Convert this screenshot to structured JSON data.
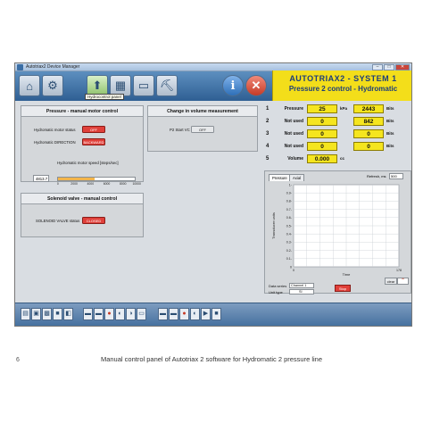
{
  "window": {
    "title": "Autotriax2 Device Manager",
    "controls": [
      "–",
      "□",
      "✕"
    ]
  },
  "toolbar": {
    "buttons": [
      {
        "name": "home-icon",
        "glyph": "⌂"
      },
      {
        "name": "settings-gear-icon",
        "glyph": "⚙"
      },
      {
        "name": "upload-arrow-icon",
        "glyph": "⬆"
      },
      {
        "name": "chart-report-icon",
        "glyph": "▦"
      },
      {
        "name": "computer-icon",
        "glyph": "▭"
      },
      {
        "name": "binoculars-icon",
        "glyph": "⛏"
      },
      {
        "name": "info-icon",
        "glyph": "i"
      },
      {
        "name": "close-cross-icon",
        "glyph": "✕"
      }
    ],
    "tooltip": "Hydrocontrol panel"
  },
  "header": {
    "system": "AUTOTRIAX2 - SYSTEM 1",
    "subtitle": "Pressure 2 control - Hydromatic"
  },
  "motor_panel": {
    "title": "Pressure - manual motor control",
    "status_label": "Hydromatic motor status",
    "status_btn": "OFF",
    "direction_label": "Hydromatic DIRECTION",
    "direction_btn": "BACKWARD",
    "speed_label": "Hydromatic motor speed [steps/sec]",
    "speed_value": "4813.7",
    "speed_fraction": 0.48,
    "ticks": [
      "0",
      "2000",
      "4000",
      "6000",
      "8000",
      "10000"
    ]
  },
  "volume_panel": {
    "title": "Change in volume measurement",
    "label": "P2 Start VC",
    "btn": "OFF"
  },
  "solenoid_panel": {
    "title": "Solenoid valve - manual control",
    "label": "SOLENOID VALVE status",
    "btn": "CLOSED"
  },
  "readouts": [
    {
      "n": "1",
      "name": "Pressure",
      "val1": "25",
      "unit1": "kPa",
      "val2": "2443",
      "unit2": "Bits"
    },
    {
      "n": "2",
      "name": "Not used",
      "val1": "0",
      "unit1": "",
      "val2": "842",
      "unit2": "Bits"
    },
    {
      "n": "3",
      "name": "Not used",
      "val1": "0",
      "unit1": "",
      "val2": "0",
      "unit2": "Bits"
    },
    {
      "n": "4",
      "name": "Not used",
      "val1": "0",
      "unit1": "",
      "val2": "0",
      "unit2": "Bits"
    },
    {
      "n": "5",
      "name": "Volume",
      "val1": "0.000",
      "unit1": "cc",
      "val2": "",
      "unit2": ""
    }
  ],
  "chart_panel": {
    "tabs": [
      "Pressure",
      "Axial"
    ],
    "refresh_label": "Refresh, ms",
    "refresh_value": "500",
    "data_series_label": "Data series",
    "data_series_value": "Channel 1",
    "unit_type_label": "Unit type",
    "unit_type_value": "SI",
    "clear_btn": "clear",
    "stop_btn": "Stop"
  },
  "chart_data": {
    "type": "line",
    "xlabel": "Time",
    "ylabel": "Transducer units",
    "x": [
      0,
      178
    ],
    "ylim": [
      0,
      1
    ],
    "xticks": [
      "0",
      "178"
    ],
    "yticks": [
      "0",
      "0.1-",
      "0.2-",
      "0.3-",
      "0.4-",
      "0.5-",
      "0.6-",
      "0.7-",
      "0.8-",
      "0.9-",
      "1-"
    ],
    "grid": true,
    "series": []
  },
  "footer_groups": [
    {
      "name": "footer-group-1",
      "icons": [
        "▤",
        "▣",
        "▩",
        "■",
        "◧"
      ]
    },
    {
      "name": "footer-group-2",
      "icons": [
        "▬",
        "▬",
        "●",
        "◐",
        "◑",
        "▭"
      ]
    },
    {
      "name": "footer-group-3",
      "icons": [
        "▬",
        "▬",
        "●",
        "◐",
        "▶",
        "■"
      ]
    }
  ],
  "caption": {
    "page_number": "6",
    "text": "Manual control panel of Autotriax 2 software for Hydromatic 2 pressure line"
  }
}
